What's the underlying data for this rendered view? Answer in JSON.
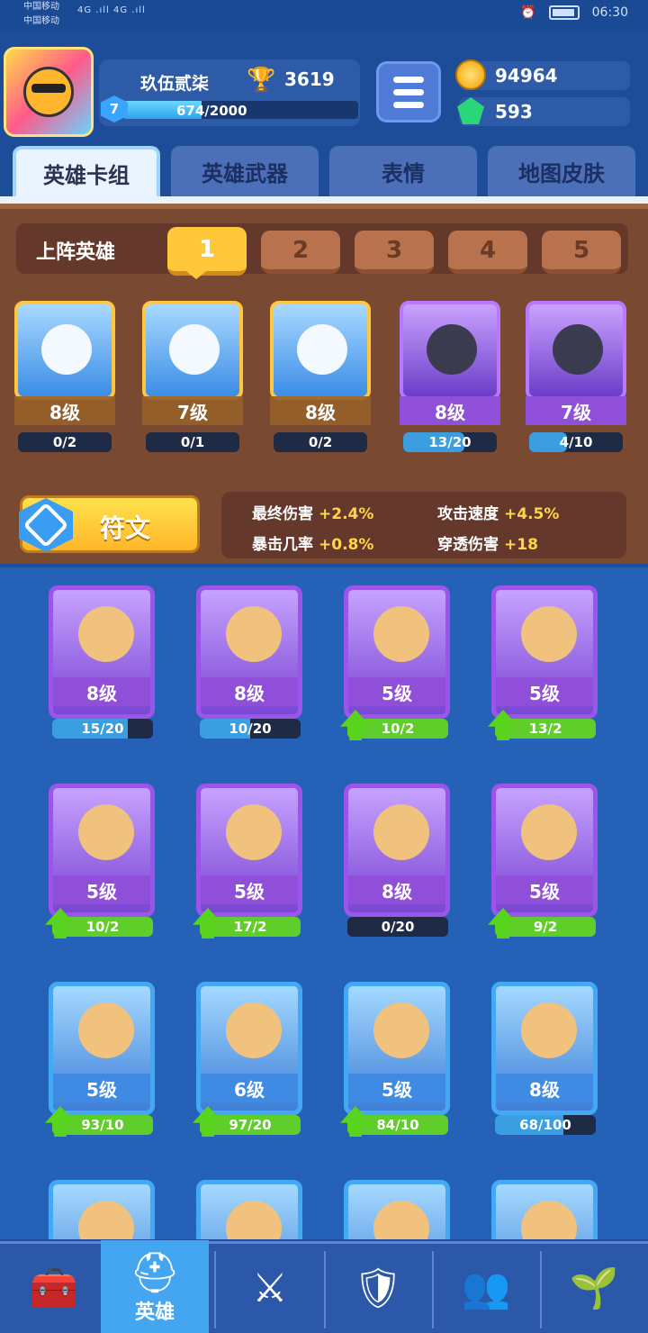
{
  "status_bar": {
    "carrier_1": "中国移动",
    "carrier_2": "中国移动",
    "network": "4G .ıll 4G .ıll",
    "time": "06:30"
  },
  "player": {
    "name": "玖伍贰柒",
    "trophies": "3619",
    "level": "7",
    "xp": "674/2000",
    "xp_fraction": 0.337
  },
  "currency": {
    "gold": "94964",
    "gems": "593"
  },
  "tabs": [
    {
      "label": "英雄卡组"
    },
    {
      "label": "英雄武器"
    },
    {
      "label": "表情"
    },
    {
      "label": "地图皮肤"
    }
  ],
  "deck": {
    "title": "上阵英雄",
    "slots": [
      "1",
      "2",
      "3",
      "4",
      "5"
    ],
    "active_slot": "1",
    "heroes": [
      {
        "level": "8级",
        "count": "0/2",
        "progress": 0,
        "rarity": "legendary"
      },
      {
        "level": "7级",
        "count": "0/1",
        "progress": 0,
        "rarity": "legendary"
      },
      {
        "level": "8级",
        "count": "0/2",
        "progress": 0,
        "rarity": "legendary"
      },
      {
        "level": "8级",
        "count": "13/20",
        "progress": 0.65,
        "rarity": "epic"
      },
      {
        "level": "7级",
        "count": "4/10",
        "progress": 0.4,
        "rarity": "epic"
      }
    ]
  },
  "rune": {
    "label": "符文"
  },
  "stats": {
    "final_damage_label": "最终伤害",
    "final_damage_value": "+2.4%",
    "attack_speed_label": "攻击速度",
    "attack_speed_value": "+4.5%",
    "crit_rate_label": "暴击几率",
    "crit_rate_value": "+0.8%",
    "pierce_label": "穿透伤害",
    "pierce_value": "+18"
  },
  "collection": [
    {
      "level": "8级",
      "count": "15/20",
      "progress": 0.75,
      "upgrade": false,
      "rarity": "epic"
    },
    {
      "level": "8级",
      "count": "10/20",
      "progress": 0.5,
      "upgrade": false,
      "rarity": "epic"
    },
    {
      "level": "5级",
      "count": "10/2",
      "progress": 1,
      "upgrade": true,
      "rarity": "epic"
    },
    {
      "level": "5级",
      "count": "13/2",
      "progress": 1,
      "upgrade": true,
      "rarity": "epic"
    },
    {
      "level": "5级",
      "count": "10/2",
      "progress": 1,
      "upgrade": true,
      "rarity": "epic"
    },
    {
      "level": "5级",
      "count": "17/2",
      "progress": 1,
      "upgrade": true,
      "rarity": "epic"
    },
    {
      "level": "8级",
      "count": "0/20",
      "progress": 0,
      "upgrade": false,
      "rarity": "epic"
    },
    {
      "level": "5级",
      "count": "9/2",
      "progress": 1,
      "upgrade": true,
      "rarity": "epic"
    },
    {
      "level": "5级",
      "count": "93/10",
      "progress": 1,
      "upgrade": true,
      "rarity": "rare"
    },
    {
      "level": "6级",
      "count": "97/20",
      "progress": 1,
      "upgrade": true,
      "rarity": "rare"
    },
    {
      "level": "5级",
      "count": "84/10",
      "progress": 1,
      "upgrade": true,
      "rarity": "rare"
    },
    {
      "level": "8级",
      "count": "68/100",
      "progress": 0.68,
      "upgrade": false,
      "rarity": "rare"
    }
  ],
  "bottom_nav": [
    {
      "icon": "treasure-chest-icon",
      "label": ""
    },
    {
      "icon": "knight-helmet-icon",
      "label": "英雄"
    },
    {
      "icon": "crossed-swords-icon",
      "label": ""
    },
    {
      "icon": "crown-shield-icon",
      "label": ""
    },
    {
      "icon": "friends-banner-icon",
      "label": ""
    },
    {
      "icon": "sprout-island-icon",
      "label": ""
    }
  ],
  "colors": {
    "background": "#1f4f9c",
    "deck_brown": "#7a4932",
    "gold": "#ffc83b",
    "epic_purple": "#9a55ea",
    "rare_blue": "#44a9f5",
    "progress_green": "#5fce2a"
  }
}
